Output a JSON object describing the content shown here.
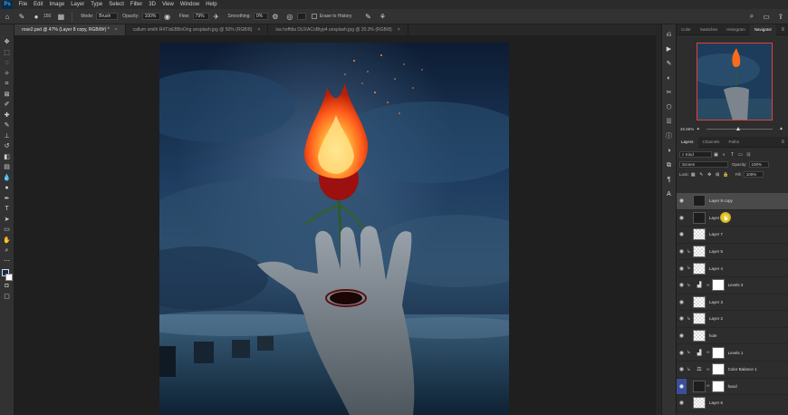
{
  "menu": {
    "logo": "Ps",
    "items": [
      "File",
      "Edit",
      "Image",
      "Layer",
      "Type",
      "Select",
      "Filter",
      "3D",
      "View",
      "Window",
      "Help"
    ]
  },
  "options": {
    "mode_label": "Mode:",
    "mode_value": "Brush",
    "opacity_label": "Opacity:",
    "opacity_value": "100%",
    "flow_label": "Flow:",
    "flow_value": "79%",
    "smoothing_label": "Smoothing:",
    "smoothing_value": "0%",
    "brush_size": "150",
    "erase_history_label": "Erase to History"
  },
  "tabs": [
    {
      "label": "rose2.psd @ 47% (Layer 8 copy, RGB/8#) *",
      "active": true
    },
    {
      "label": "callum smith R4TIxEBBoOng unsplash.jpg @ 50% (RGB/8)",
      "active": false
    },
    {
      "label": "isa hoffdia DUXACoBtyp4 unsplash.jpg @ 20.3% (RGB/8)",
      "active": false
    }
  ],
  "panels": {
    "top_tabs": [
      "Color",
      "Swatches",
      "Histogram",
      "Navigator"
    ],
    "top_active": "Navigator",
    "zoom": "46.96%",
    "layer_tabs": [
      "Layers",
      "Channels",
      "Paths"
    ],
    "layer_active": "Layers",
    "filter_kind": "Kind",
    "blend_mode": "Screen",
    "opacity_label": "Opacity:",
    "opacity_value": "100%",
    "lock_label": "Lock:",
    "fill_label": "Fill:",
    "fill_value": "100%"
  },
  "layers": [
    {
      "name": "Layer 8 copy",
      "selected": true,
      "clip": false,
      "thumb": "pixel-dark",
      "mask": false
    },
    {
      "name": "Layer 8",
      "selected": false,
      "clip": false,
      "thumb": "pixel-dark",
      "mask": false
    },
    {
      "name": "Layer 7",
      "selected": false,
      "clip": false,
      "thumb": "pixel",
      "mask": false
    },
    {
      "name": "Layer 5",
      "selected": false,
      "clip": true,
      "thumb": "pixel",
      "mask": false
    },
    {
      "name": "Layer 4",
      "selected": false,
      "clip": true,
      "thumb": "pixel",
      "mask": false
    },
    {
      "name": "Levels 3",
      "selected": false,
      "clip": true,
      "thumb": "adjust",
      "mask": true
    },
    {
      "name": "Layer 3",
      "selected": false,
      "clip": false,
      "thumb": "pixel",
      "mask": false
    },
    {
      "name": "Layer 2",
      "selected": false,
      "clip": true,
      "thumb": "pixel",
      "mask": false
    },
    {
      "name": "hole",
      "selected": false,
      "clip": false,
      "thumb": "pixel",
      "mask": false
    },
    {
      "name": "Levels 1",
      "selected": false,
      "clip": true,
      "thumb": "adjust",
      "mask": true
    },
    {
      "name": "Color Balance 1",
      "selected": false,
      "clip": true,
      "thumb": "balance",
      "mask": true
    },
    {
      "name": "hand",
      "selected": false,
      "clip": false,
      "thumb": "pixel-dark",
      "mask": true,
      "eye_highlight": true
    },
    {
      "name": "Layer 6",
      "selected": false,
      "clip": false,
      "thumb": "pixel",
      "mask": false
    }
  ],
  "colors": {
    "accent_selected_eye": "#3b4f99",
    "nav_frame": "#e0403a",
    "foreground_swatch": "#0f2d55",
    "background_swatch": "#ffffff"
  }
}
